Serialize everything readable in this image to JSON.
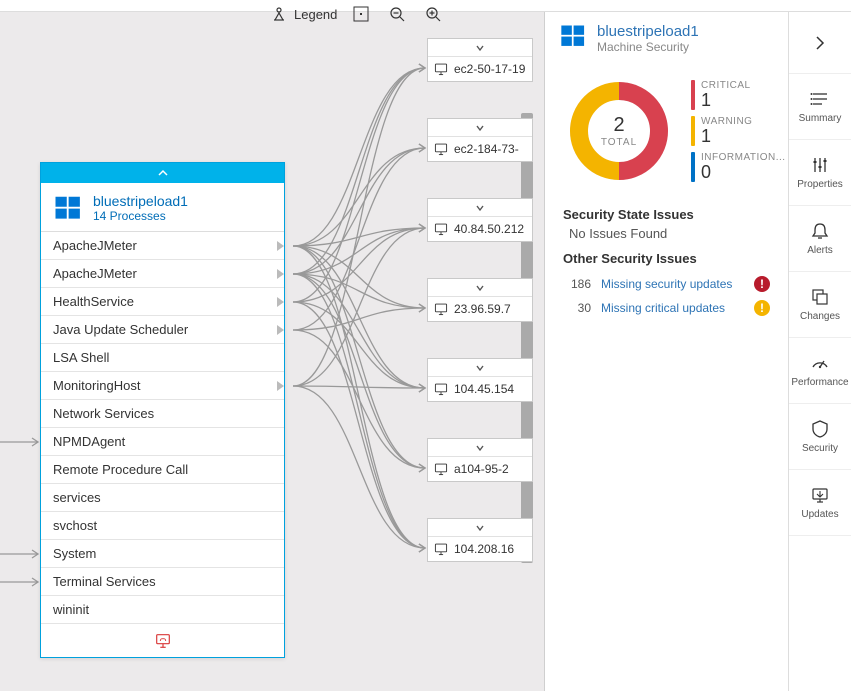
{
  "toolbar": {
    "legend_label": "Legend"
  },
  "machine": {
    "name": "bluestripeload1",
    "subtitle": "14 Processes",
    "processes": [
      {
        "name": "ApacheJMeter",
        "out": true
      },
      {
        "name": "ApacheJMeter",
        "out": true
      },
      {
        "name": "HealthService",
        "out": true
      },
      {
        "name": "Java Update Scheduler",
        "out": true
      },
      {
        "name": "LSA Shell",
        "out": false
      },
      {
        "name": "MonitoringHost",
        "out": true
      },
      {
        "name": "Network Services",
        "out": false
      },
      {
        "name": "NPMDAgent",
        "out": false
      },
      {
        "name": "Remote Procedure Call",
        "out": false
      },
      {
        "name": "services",
        "out": false
      },
      {
        "name": "svchost",
        "out": false
      },
      {
        "name": "System",
        "out": false
      },
      {
        "name": "Terminal Services",
        "out": false
      },
      {
        "name": "wininit",
        "out": false
      }
    ]
  },
  "targets": [
    {
      "label": "ec2-50-17-19"
    },
    {
      "label": "ec2-184-73-"
    },
    {
      "label": "40.84.50.212"
    },
    {
      "label": "23.96.59.7"
    },
    {
      "label": "104.45.154"
    },
    {
      "label": "a104-95-2"
    },
    {
      "label": "104.208.16"
    }
  ],
  "panel": {
    "title": "bluestripeload1",
    "subtitle": "Machine Security",
    "total_value": "2",
    "total_label": "TOTAL",
    "legend": [
      {
        "label": "CRITICAL",
        "value": "1",
        "color": "#d8414f"
      },
      {
        "label": "WARNING",
        "value": "1",
        "color": "#f4b400"
      },
      {
        "label": "INFORMATION...",
        "value": "0",
        "color": "#0072c6"
      }
    ],
    "state_title": "Security State Issues",
    "state_text": "No Issues Found",
    "other_title": "Other Security Issues",
    "other_issues": [
      {
        "count": "186",
        "text": "Missing security updates",
        "badge": "red"
      },
      {
        "count": "30",
        "text": "Missing critical updates",
        "badge": "yel"
      }
    ]
  },
  "rail": {
    "items": [
      {
        "label": "Summary",
        "icon": "summary"
      },
      {
        "label": "Properties",
        "icon": "properties"
      },
      {
        "label": "Alerts",
        "icon": "alerts"
      },
      {
        "label": "Changes",
        "icon": "changes"
      },
      {
        "label": "Performance",
        "icon": "performance"
      },
      {
        "label": "Security",
        "icon": "security"
      },
      {
        "label": "Updates",
        "icon": "updates"
      }
    ]
  },
  "chart_data": {
    "type": "pie",
    "title": "Machine Security",
    "categories": [
      "Critical",
      "Warning",
      "Information"
    ],
    "values": [
      1,
      1,
      0
    ],
    "total": 2,
    "colors": [
      "#d8414f",
      "#f4b400",
      "#0072c6"
    ]
  }
}
